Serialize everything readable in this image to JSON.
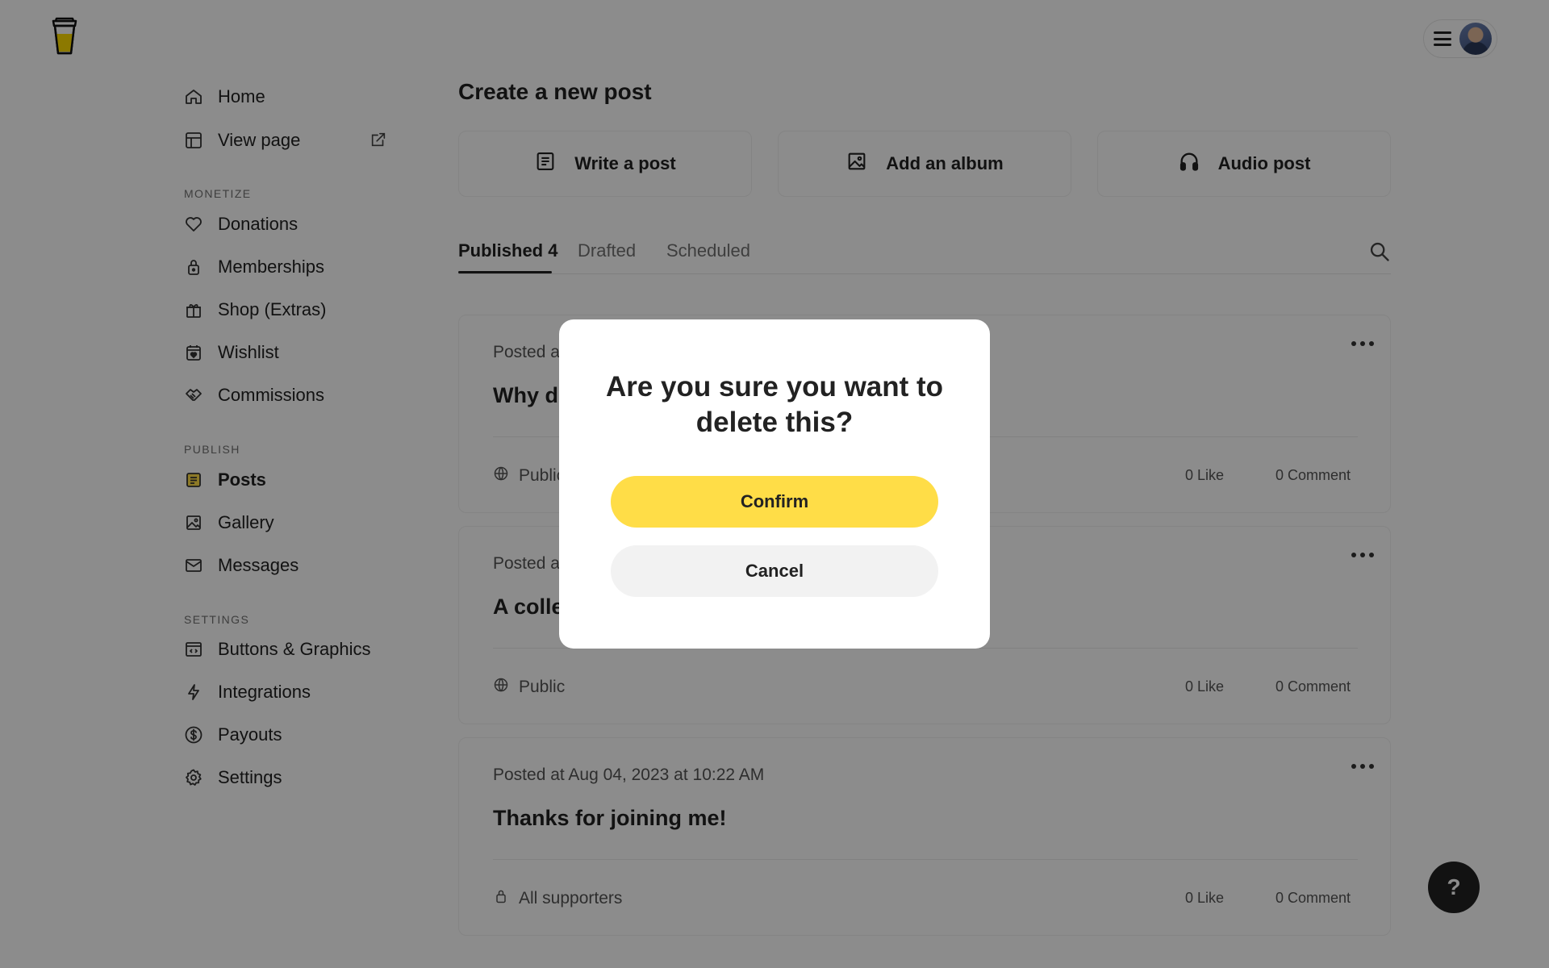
{
  "header": {
    "logo_icon": "coffee-cup-logo-icon",
    "menu_icon": "hamburger-icon",
    "avatar_icon": "user-avatar"
  },
  "sidebar": {
    "items_top": [
      {
        "label": "Home",
        "icon": "home-icon"
      },
      {
        "label": "View page",
        "icon": "layout-icon"
      }
    ],
    "monetize_label": "MONETIZE",
    "monetize_items": [
      {
        "label": "Donations",
        "icon": "heart-icon"
      },
      {
        "label": "Memberships",
        "icon": "lock-icon"
      },
      {
        "label": "Shop (Extras)",
        "icon": "gift-icon"
      },
      {
        "label": "Wishlist",
        "icon": "calendar-heart-icon"
      },
      {
        "label": "Commissions",
        "icon": "handshake-icon"
      }
    ],
    "publish_label": "PUBLISH",
    "publish_items": [
      {
        "label": "Posts",
        "icon": "document-icon"
      },
      {
        "label": "Gallery",
        "icon": "image-icon"
      },
      {
        "label": "Messages",
        "icon": "mail-icon"
      }
    ],
    "settings_label": "SETTINGS",
    "settings_items": [
      {
        "label": "Buttons & Graphics",
        "icon": "code-window-icon"
      },
      {
        "label": "Integrations",
        "icon": "bolt-icon"
      },
      {
        "label": "Payouts",
        "icon": "dollar-icon"
      },
      {
        "label": "Settings",
        "icon": "gear-icon"
      }
    ]
  },
  "main": {
    "title": "Create a new post",
    "create_options": [
      {
        "label": "Write a post",
        "icon": "document-icon"
      },
      {
        "label": "Add an album",
        "icon": "image-icon"
      },
      {
        "label": "Audio post",
        "icon": "headphones-icon"
      }
    ],
    "tabs": [
      {
        "label": "Published 4"
      },
      {
        "label": "Drafted"
      },
      {
        "label": "Scheduled"
      }
    ],
    "posts": [
      {
        "meta": "Posted a",
        "title": "Why d",
        "visibility": "Public",
        "likes": "0 Like",
        "comments": "0 Comment"
      },
      {
        "meta": "Posted a",
        "title": "A colle",
        "visibility": "Public",
        "likes": "0 Like",
        "comments": "0 Comment"
      },
      {
        "meta": "Posted at Aug 04, 2023 at 10:22 AM",
        "title": "Thanks for joining me!",
        "visibility": "All supporters",
        "likes": "0 Like",
        "comments": "0 Comment"
      }
    ]
  },
  "help": {
    "label": "?"
  },
  "modal": {
    "title": "Are you sure you want to delete this?",
    "confirm_label": "Confirm",
    "cancel_label": "Cancel"
  },
  "colors": {
    "accent_yellow": "#ffdd47",
    "text_dark": "#222222",
    "text_muted": "#717171",
    "overlay": "rgba(0,0,0,0.45)"
  }
}
